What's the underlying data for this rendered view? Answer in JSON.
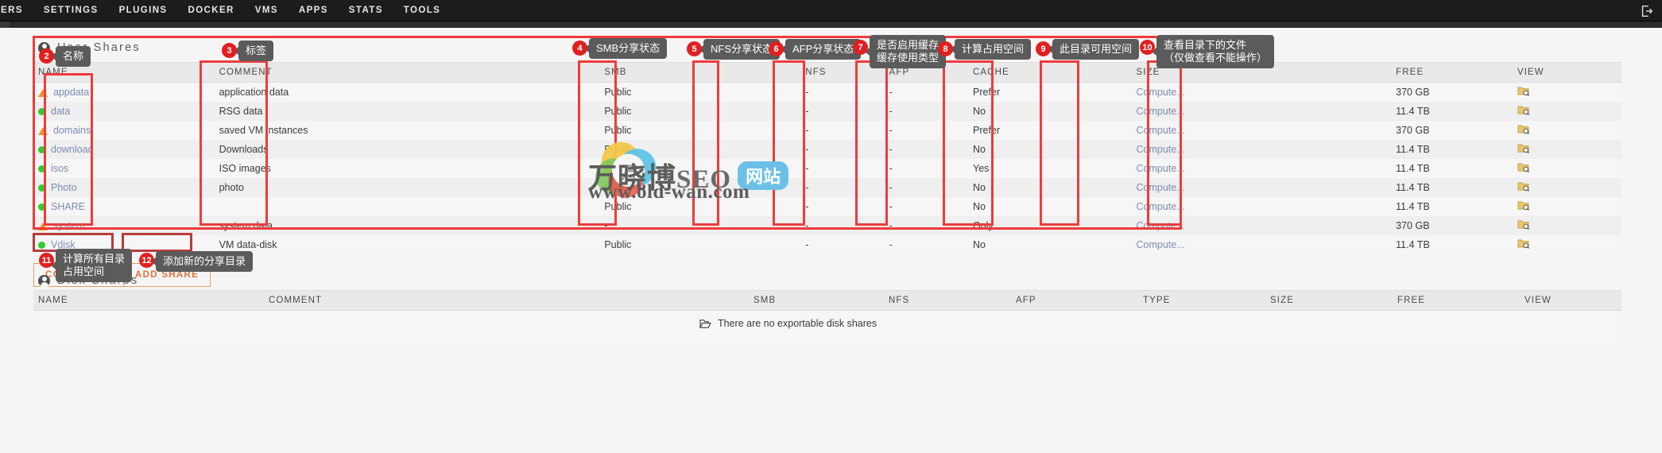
{
  "topnav": {
    "items": [
      {
        "label": "ERS"
      },
      {
        "label": "SETTINGS"
      },
      {
        "label": "PLUGINS"
      },
      {
        "label": "DOCKER"
      },
      {
        "label": "VMS"
      },
      {
        "label": "APPS"
      },
      {
        "label": "STATS"
      },
      {
        "label": "TOOLS"
      }
    ],
    "logout_icon": "logout-icon"
  },
  "user_shares": {
    "title": "User Shares",
    "columns": [
      "NAME",
      "COMMENT",
      "SMB",
      "NFS",
      "AFP",
      "CACHE",
      "SIZE",
      "FREE",
      "VIEW"
    ],
    "rows": [
      {
        "status": "warning",
        "name": "appdata",
        "comment": "application data",
        "smb": "Public",
        "nfs": "-",
        "afp": "-",
        "cache": "Prefer",
        "size": "Compute...",
        "free": "370 GB",
        "view": "view-folder-icon"
      },
      {
        "status": "ok",
        "name": "data",
        "comment": "RSG data",
        "smb": "Public",
        "nfs": "-",
        "afp": "-",
        "cache": "No",
        "size": "Compute...",
        "free": "11.4 TB",
        "view": "view-folder-icon"
      },
      {
        "status": "warning",
        "name": "domains",
        "comment": "saved VM instances",
        "smb": "Public",
        "nfs": "-",
        "afp": "-",
        "cache": "Prefer",
        "size": "Compute...",
        "free": "370 GB",
        "view": "view-folder-icon"
      },
      {
        "status": "ok",
        "name": "download",
        "comment": "Downloads",
        "smb": "Public",
        "nfs": "-",
        "afp": "-",
        "cache": "No",
        "size": "Compute...",
        "free": "11.4 TB",
        "view": "view-folder-icon"
      },
      {
        "status": "ok",
        "name": "isos",
        "comment": "ISO images",
        "smb": "Public",
        "nfs": "-",
        "afp": "-",
        "cache": "Yes",
        "size": "Compute...",
        "free": "11.4 TB",
        "view": "view-folder-icon"
      },
      {
        "status": "ok",
        "name": "Photo",
        "comment": "photo",
        "smb": "Public",
        "nfs": "-",
        "afp": "-",
        "cache": "No",
        "size": "Compute...",
        "free": "11.4 TB",
        "view": "view-folder-icon"
      },
      {
        "status": "ok",
        "name": "SHARE",
        "comment": "",
        "smb": "Public",
        "nfs": "-",
        "afp": "-",
        "cache": "No",
        "size": "Compute...",
        "free": "11.4 TB",
        "view": "view-folder-icon"
      },
      {
        "status": "warning",
        "name": "system",
        "comment": "system data",
        "smb": "-",
        "nfs": "-",
        "afp": "-",
        "cache": "Only",
        "size": "Compute...",
        "free": "370 GB",
        "view": "view-folder-icon"
      },
      {
        "status": "ok",
        "name": "Vdisk",
        "comment": "VM data-disk",
        "smb": "Public",
        "nfs": "-",
        "afp": "-",
        "cache": "No",
        "size": "Compute...",
        "free": "11.4 TB",
        "view": "view-folder-icon"
      }
    ],
    "compute_all_label": "COMPUTE ALL",
    "add_share_label": "ADD SHARE"
  },
  "disk_shares": {
    "title": "Disk Shares",
    "columns": [
      "NAME",
      "COMMENT",
      "SMB",
      "NFS",
      "AFP",
      "TYPE",
      "SIZE",
      "FREE",
      "VIEW"
    ],
    "empty_message": "There are no exportable disk shares"
  },
  "annotations": [
    {
      "num": "2",
      "text": "名称"
    },
    {
      "num": "3",
      "text": "标签"
    },
    {
      "num": "4",
      "text": "SMB分享状态"
    },
    {
      "num": "5",
      "text": "NFS分享状态"
    },
    {
      "num": "6",
      "text": "AFP分享状态"
    },
    {
      "num": "7",
      "text": "是否启用缓存\n缓存使用类型"
    },
    {
      "num": "8",
      "text": "计算占用空间"
    },
    {
      "num": "9",
      "text": "此目录可用空间"
    },
    {
      "num": "10",
      "text": "查看目录下的文件\n（仅做查看不能操作）"
    },
    {
      "num": "11",
      "text": "计算所有目录\n占用空间"
    },
    {
      "num": "12",
      "text": "添加新的分享目录"
    }
  ],
  "watermark": {
    "cn": "万晓博",
    "en": "SEO",
    "pill": "网站",
    "url": "www.old-wan.com"
  },
  "colors": {
    "accent_red": "#ef3b3b",
    "badge_red": "#e02020",
    "status_ok": "#2ecc2e",
    "status_warn": "#f0922b",
    "link_blue": "#7b8cb1",
    "button_orange": "#e8713c"
  }
}
